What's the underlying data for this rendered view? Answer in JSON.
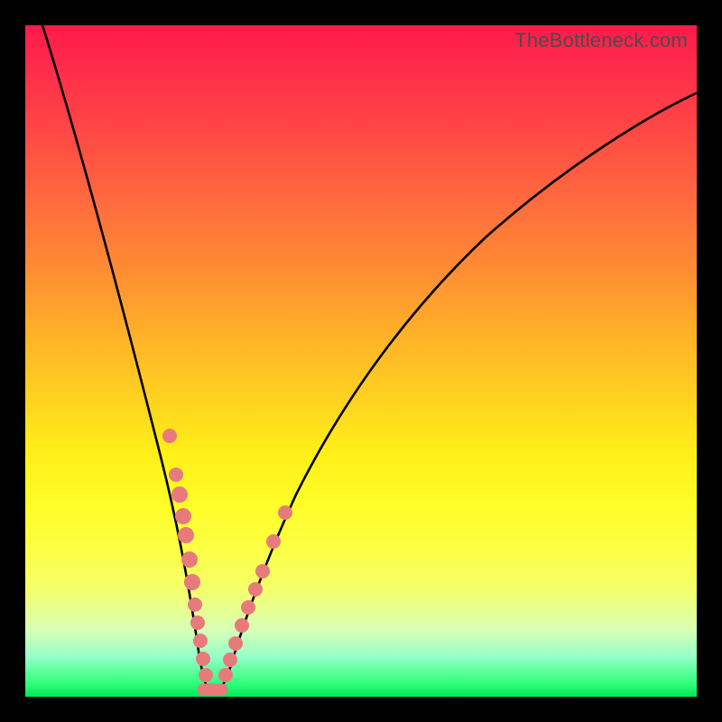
{
  "watermark": "TheBottleneck.com",
  "colors": {
    "dot": "#e77b7b",
    "curve": "#000000"
  },
  "chart_data": {
    "type": "line",
    "title": "",
    "xlabel": "",
    "ylabel": "",
    "xlim": [
      0,
      100
    ],
    "ylim": [
      0,
      100
    ],
    "note": "Qualitative bottleneck V-curve. y≈100 means severe bottleneck (red), y≈0 means balanced (green). Axes are unlabeled in source image; values below are estimated from pixel geometry.",
    "series": [
      {
        "name": "bottleneck-curve",
        "x": [
          0,
          4,
          8,
          12,
          15,
          18,
          20,
          22,
          23.5,
          25,
          27,
          28.5,
          30,
          33,
          36,
          40,
          45,
          50,
          56,
          63,
          72,
          82,
          92,
          100
        ],
        "y": [
          100,
          90,
          79,
          67,
          56,
          44,
          33,
          22,
          12,
          4,
          0,
          0,
          3,
          9,
          16,
          24,
          33,
          43,
          52,
          62,
          72,
          81,
          88,
          92
        ]
      }
    ],
    "markers": {
      "name": "highlighted-points",
      "comment": "Salmon marker dots on the curve near the minimum",
      "x": [
        18.5,
        19.9,
        20.6,
        21.3,
        21.9,
        22.6,
        23.2,
        23.7,
        24.2,
        24.9,
        25.6,
        26.4,
        28.3,
        29.2,
        30.0,
        30.8,
        31.6,
        32.6,
        33.4,
        34.9,
        36.4
      ],
      "y": [
        40.0,
        33.2,
        29.6,
        25.8,
        22.4,
        18.0,
        14.0,
        10.0,
        6.8,
        3.6,
        1.7,
        0.8,
        1.2,
        2.8,
        5.0,
        7.2,
        9.6,
        12.6,
        15.2,
        20.2,
        25.0
      ]
    }
  }
}
